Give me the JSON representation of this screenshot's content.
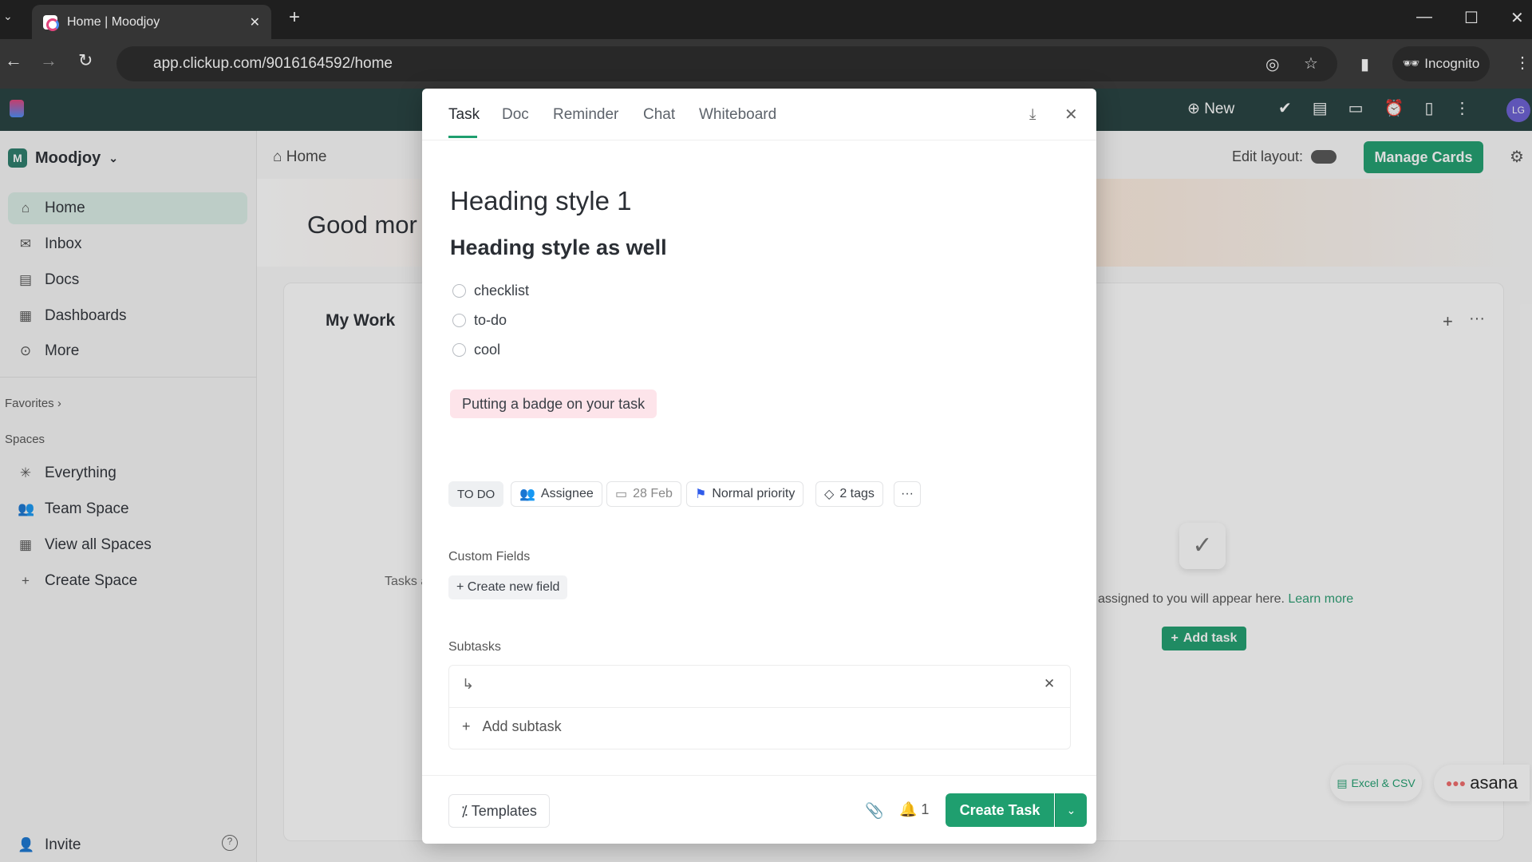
{
  "browser": {
    "tab_title": "Home | Moodjoy",
    "url": "app.clickup.com/9016164592/home",
    "incognito": "Incognito"
  },
  "topbar": {
    "new": "New",
    "avatar": "LG"
  },
  "sidebar": {
    "workspace": "Moodjoy",
    "workspace_initial": "M",
    "items": [
      {
        "label": "Home",
        "icon": "home-icon"
      },
      {
        "label": "Inbox",
        "icon": "inbox-icon"
      },
      {
        "label": "Docs",
        "icon": "doc-icon"
      },
      {
        "label": "Dashboards",
        "icon": "dashboard-icon"
      },
      {
        "label": "More",
        "icon": "more-icon"
      }
    ],
    "favorites": "Favorites",
    "spaces": "Spaces",
    "space_items": [
      {
        "label": "Everything"
      },
      {
        "label": "Team Space"
      },
      {
        "label": "View all Spaces"
      },
      {
        "label": "Create Space"
      }
    ],
    "invite": "Invite"
  },
  "main": {
    "breadcrumb": "Home",
    "greeting": "Good mor",
    "my_work": "My Work",
    "tasks_fragment": "Tasks a",
    "edit_layout": "Edit layout:",
    "manage_cards": "Manage Cards",
    "empty_text": "assigned to you will appear here.",
    "learn_more": "Learn more",
    "add_task": "Add task",
    "import_excel": "Excel & CSV",
    "import_asana": "asana"
  },
  "modal": {
    "tabs": [
      "Task",
      "Doc",
      "Reminder",
      "Chat",
      "Whiteboard"
    ],
    "active_tab": "Task",
    "heading1": "Heading style 1",
    "heading2": "Heading style as well",
    "checklist": [
      "checklist",
      "to-do",
      "cool"
    ],
    "badge": "Putting a badge on your task",
    "status": "TO DO",
    "assignee": "Assignee",
    "date": "28 Feb",
    "priority": "Normal priority",
    "tags": "2 tags",
    "custom_fields": "Custom Fields",
    "create_field": "Create new field",
    "subtasks": "Subtasks",
    "add_subtask": "Add subtask",
    "templates": "Templates",
    "reminder_count": "1",
    "create_task": "Create Task"
  },
  "colors": {
    "accent": "#1f9f6f",
    "badge_bg": "#fde4ea",
    "priority_flag": "#2f5bea"
  }
}
